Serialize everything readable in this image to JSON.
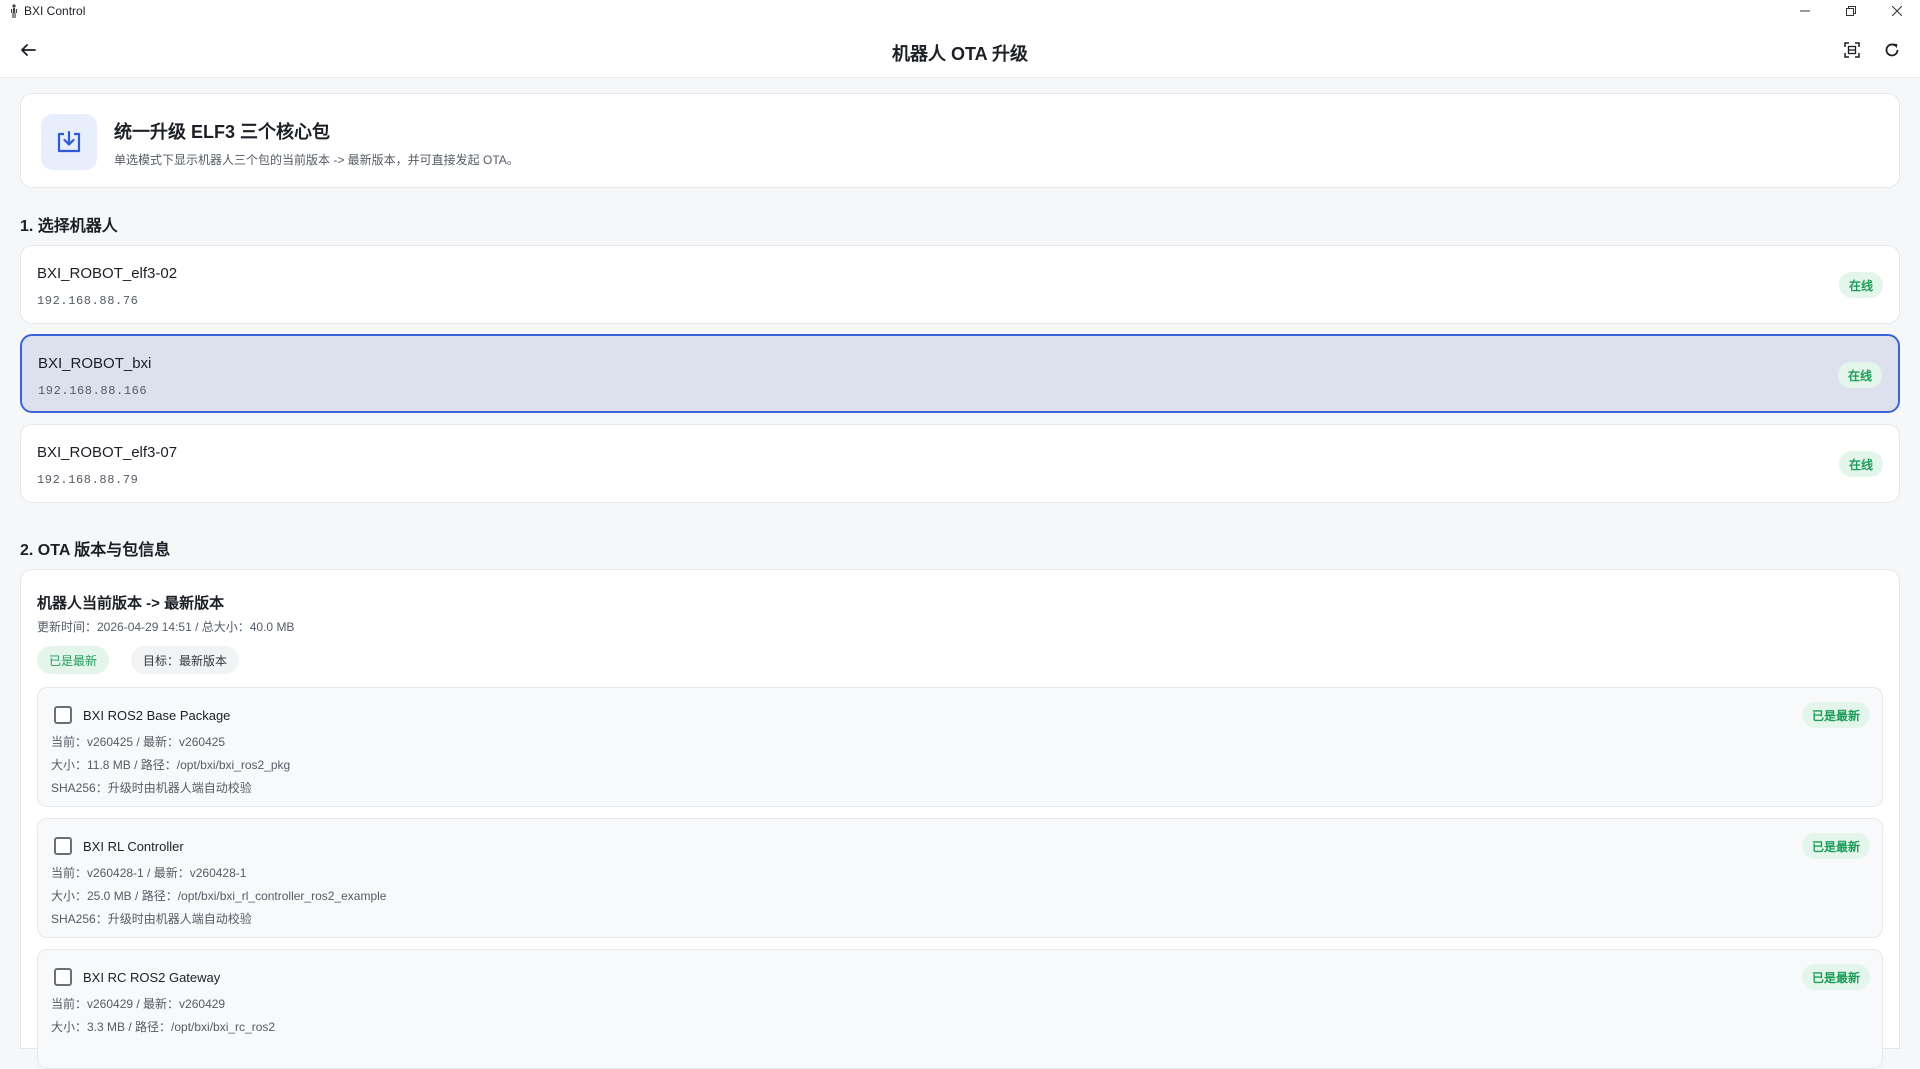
{
  "window": {
    "title": "BXI Control",
    "controls": [
      "minimize-icon",
      "restore-icon",
      "close-icon"
    ]
  },
  "appbar": {
    "title": "机器人 OTA 升级",
    "icons": [
      "back-arrow-icon",
      "scan-icon",
      "refresh-icon"
    ]
  },
  "hero": {
    "icon": "download-icon",
    "title": "统一升级 ELF3 三个核心包",
    "description": "单选模式下显示机器人三个包的当前版本 -> 最新版本，并可直接发起 OTA。"
  },
  "section1": {
    "title": "1. 选择机器人"
  },
  "robots": [
    {
      "name": "BXI_ROBOT_elf3-02",
      "ip": "192.168.88.76",
      "status": "在线",
      "selected": false
    },
    {
      "name": "BXI_ROBOT_bxi",
      "ip": "192.168.88.166",
      "status": "在线",
      "selected": true
    },
    {
      "name": "BXI_ROBOT_elf3-07",
      "ip": "192.168.88.79",
      "status": "在线",
      "selected": false
    }
  ],
  "section2": {
    "title": "2. OTA 版本与包信息"
  },
  "ota": {
    "title": "机器人当前版本 -> 最新版本",
    "meta": "更新时间：2026-04-29 14:51  /  总大小：40.0 MB",
    "status_chip": "已是最新",
    "target_chip": "目标：最新版本"
  },
  "packages": [
    {
      "name": "BXI ROS2 Base Package",
      "version": "当前：v260425  /  最新：v260425",
      "size_path": "大小：11.8 MB  /  路径：/opt/bxi/bxi_ros2_pkg",
      "sha": "SHA256：升级时由机器人端自动校验",
      "status": "已是最新"
    },
    {
      "name": "BXI RL Controller",
      "version": "当前：v260428-1  /  最新：v260428-1",
      "size_path": "大小：25.0 MB  /  路径：/opt/bxi/bxi_rl_controller_ros2_example",
      "sha": "SHA256：升级时由机器人端自动校验",
      "status": "已是最新"
    },
    {
      "name": "BXI RC ROS2 Gateway",
      "version": "当前：v260429  /  最新：v260429",
      "size_path": "大小：3.3 MB  /  路径：/opt/bxi/bxi_rc_ros2",
      "sha": "",
      "status": "已是最新"
    }
  ]
}
